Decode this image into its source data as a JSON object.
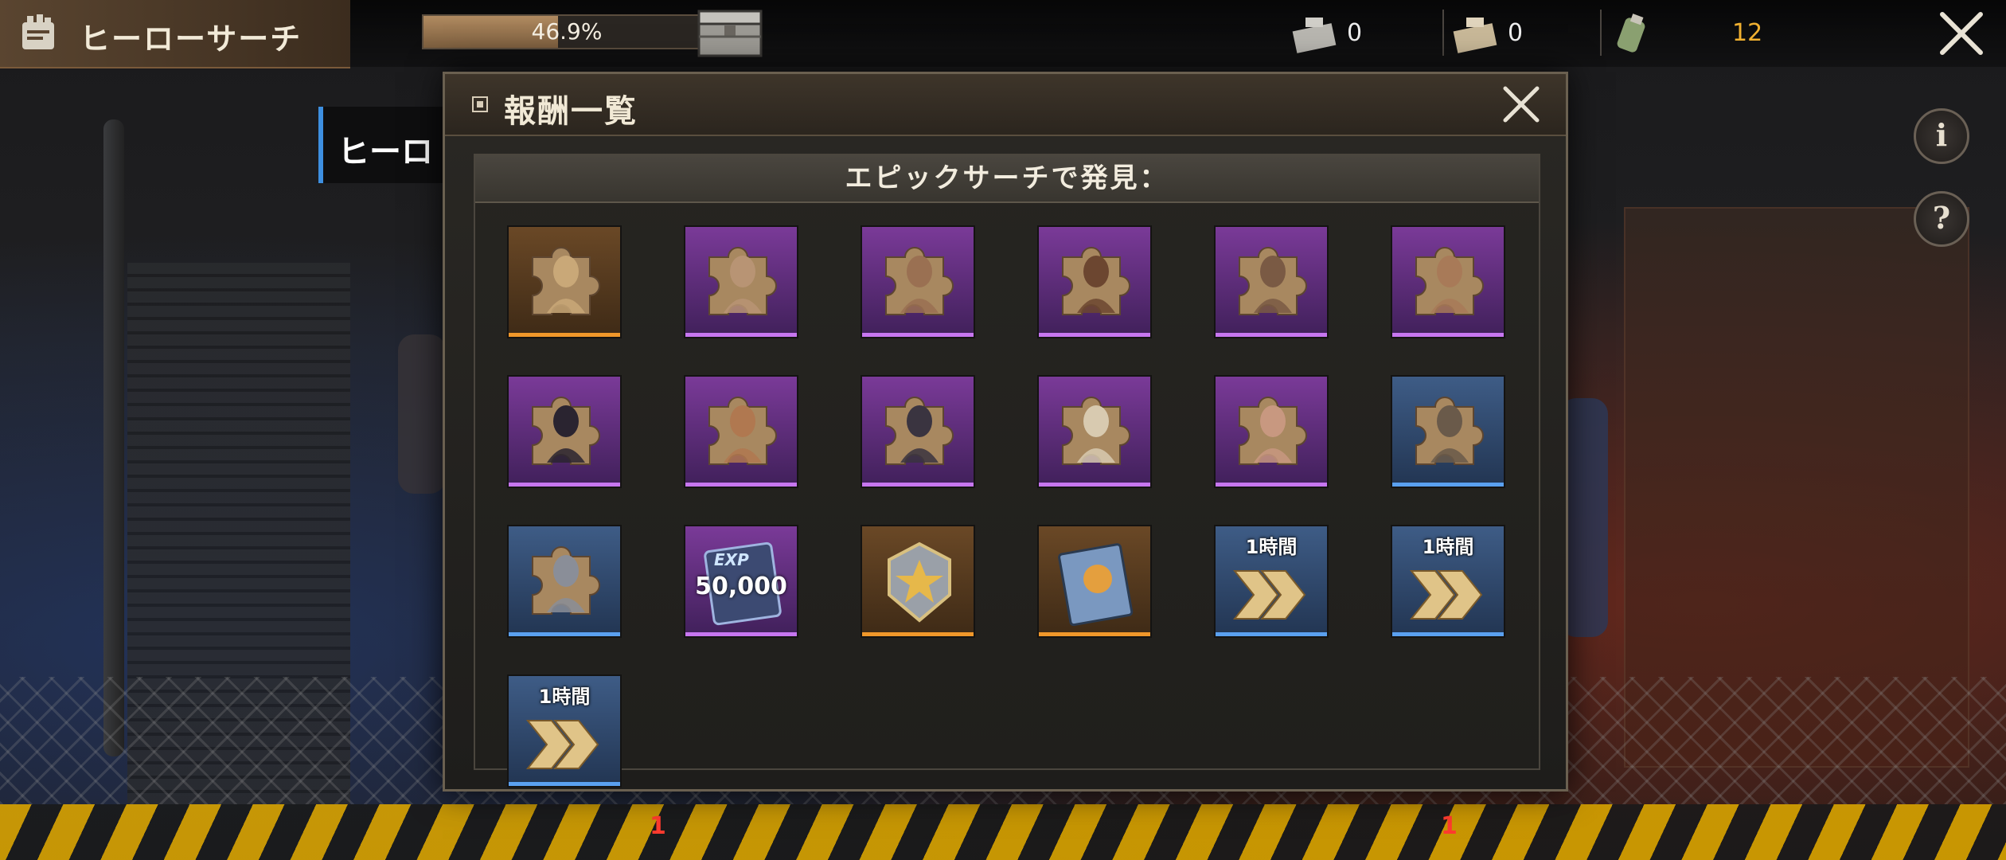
{
  "header": {
    "title": "ヒーローサーチ",
    "progress_text": "46.9%",
    "progress_value": 0.469,
    "resources": [
      {
        "icon": "ticket-icon",
        "value": "0"
      },
      {
        "icon": "epic-ticket-icon",
        "value": "0"
      },
      {
        "icon": "canister-icon",
        "value": "12"
      }
    ]
  },
  "side": {
    "tab_label": "ヒーロ",
    "info_label": "i",
    "help_label": "?",
    "bottom_counts": [
      "1",
      "1"
    ]
  },
  "modal": {
    "title": "報酬一覧",
    "section_title": "エピックサーチで発見：",
    "rewards": [
      {
        "kind": "hero-fragment",
        "rarity": "orange",
        "hero_color": "#c9a878"
      },
      {
        "kind": "hero-fragment",
        "rarity": "purple",
        "hero_color": "#b89474"
      },
      {
        "kind": "hero-fragment",
        "rarity": "purple",
        "hero_color": "#9a7052"
      },
      {
        "kind": "hero-fragment",
        "rarity": "purple",
        "hero_color": "#6c4630"
      },
      {
        "kind": "hero-fragment",
        "rarity": "purple",
        "hero_color": "#7a5a44"
      },
      {
        "kind": "hero-fragment",
        "rarity": "purple",
        "hero_color": "#a87a58"
      },
      {
        "kind": "hero-fragment",
        "rarity": "purple",
        "hero_color": "#2a2430"
      },
      {
        "kind": "hero-fragment",
        "rarity": "purple",
        "hero_color": "#b07850"
      },
      {
        "kind": "hero-fragment",
        "rarity": "purple",
        "hero_color": "#3a3440"
      },
      {
        "kind": "hero-fragment",
        "rarity": "purple",
        "hero_color": "#d8cab0"
      },
      {
        "kind": "hero-fragment",
        "rarity": "purple",
        "hero_color": "#c89880"
      },
      {
        "kind": "hero-fragment",
        "rarity": "blue",
        "hero_color": "#6a5a4a"
      },
      {
        "kind": "hero-fragment",
        "rarity": "blue",
        "hero_color": "#8a8e98"
      },
      {
        "kind": "exp-book",
        "rarity": "purple",
        "label": "50,000",
        "tag": "EXP"
      },
      {
        "kind": "star-badge",
        "rarity": "orange"
      },
      {
        "kind": "manual",
        "rarity": "orange"
      },
      {
        "kind": "speedup",
        "rarity": "blue",
        "time": "1時間"
      },
      {
        "kind": "speedup",
        "rarity": "blue",
        "time": "1時間"
      },
      {
        "kind": "speedup",
        "rarity": "blue",
        "time": "1時間"
      }
    ]
  }
}
